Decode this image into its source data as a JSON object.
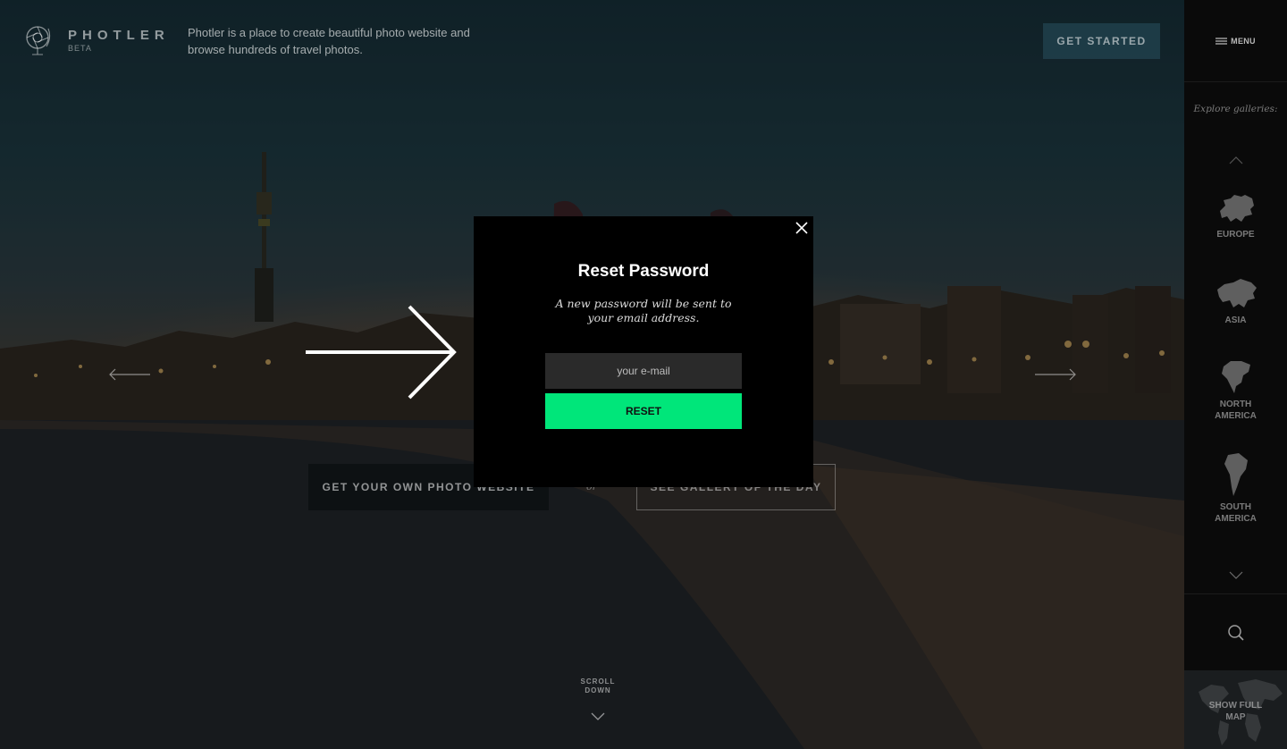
{
  "brand": {
    "name": "PHOTLER",
    "badge": "BETA",
    "tagline": "Photler is a place to create beautiful photo website and browse hundreds of travel photos."
  },
  "header": {
    "cta_label": "GET STARTED"
  },
  "hero": {
    "own_site_label": "GET YOUR OWN PHOTO WEBSITE",
    "or_label": "or",
    "gallery_label": "SEE GALLERY OF THE DAY",
    "scroll_label_1": "SCROLL",
    "scroll_label_2": "DOWN"
  },
  "modal": {
    "title": "Reset Password",
    "description": "A new password will be sent to your email address.",
    "email_placeholder": "your e-mail",
    "email_value": "",
    "submit_label": "RESET"
  },
  "sidebar": {
    "menu_label": "MENU",
    "explore_label": "Explore galleries:",
    "continents": [
      {
        "line1": "EUROPE",
        "line2": ""
      },
      {
        "line1": "ASIA",
        "line2": ""
      },
      {
        "line1": "NORTH",
        "line2": "AMERICA"
      },
      {
        "line1": "SOUTH",
        "line2": "AMERICA"
      }
    ],
    "full_map_line1": "SHOW FULL",
    "full_map_line2": "MAP"
  },
  "colors": {
    "accent": "#00e67a",
    "modal_bg": "#000000",
    "sidebar_bg": "#0a0a0a"
  },
  "icons": {
    "logo": "globe-aperture-icon",
    "close": "close-icon",
    "menu": "hamburger-icon",
    "search": "search-icon",
    "arrow": "arrow-right-icon"
  }
}
